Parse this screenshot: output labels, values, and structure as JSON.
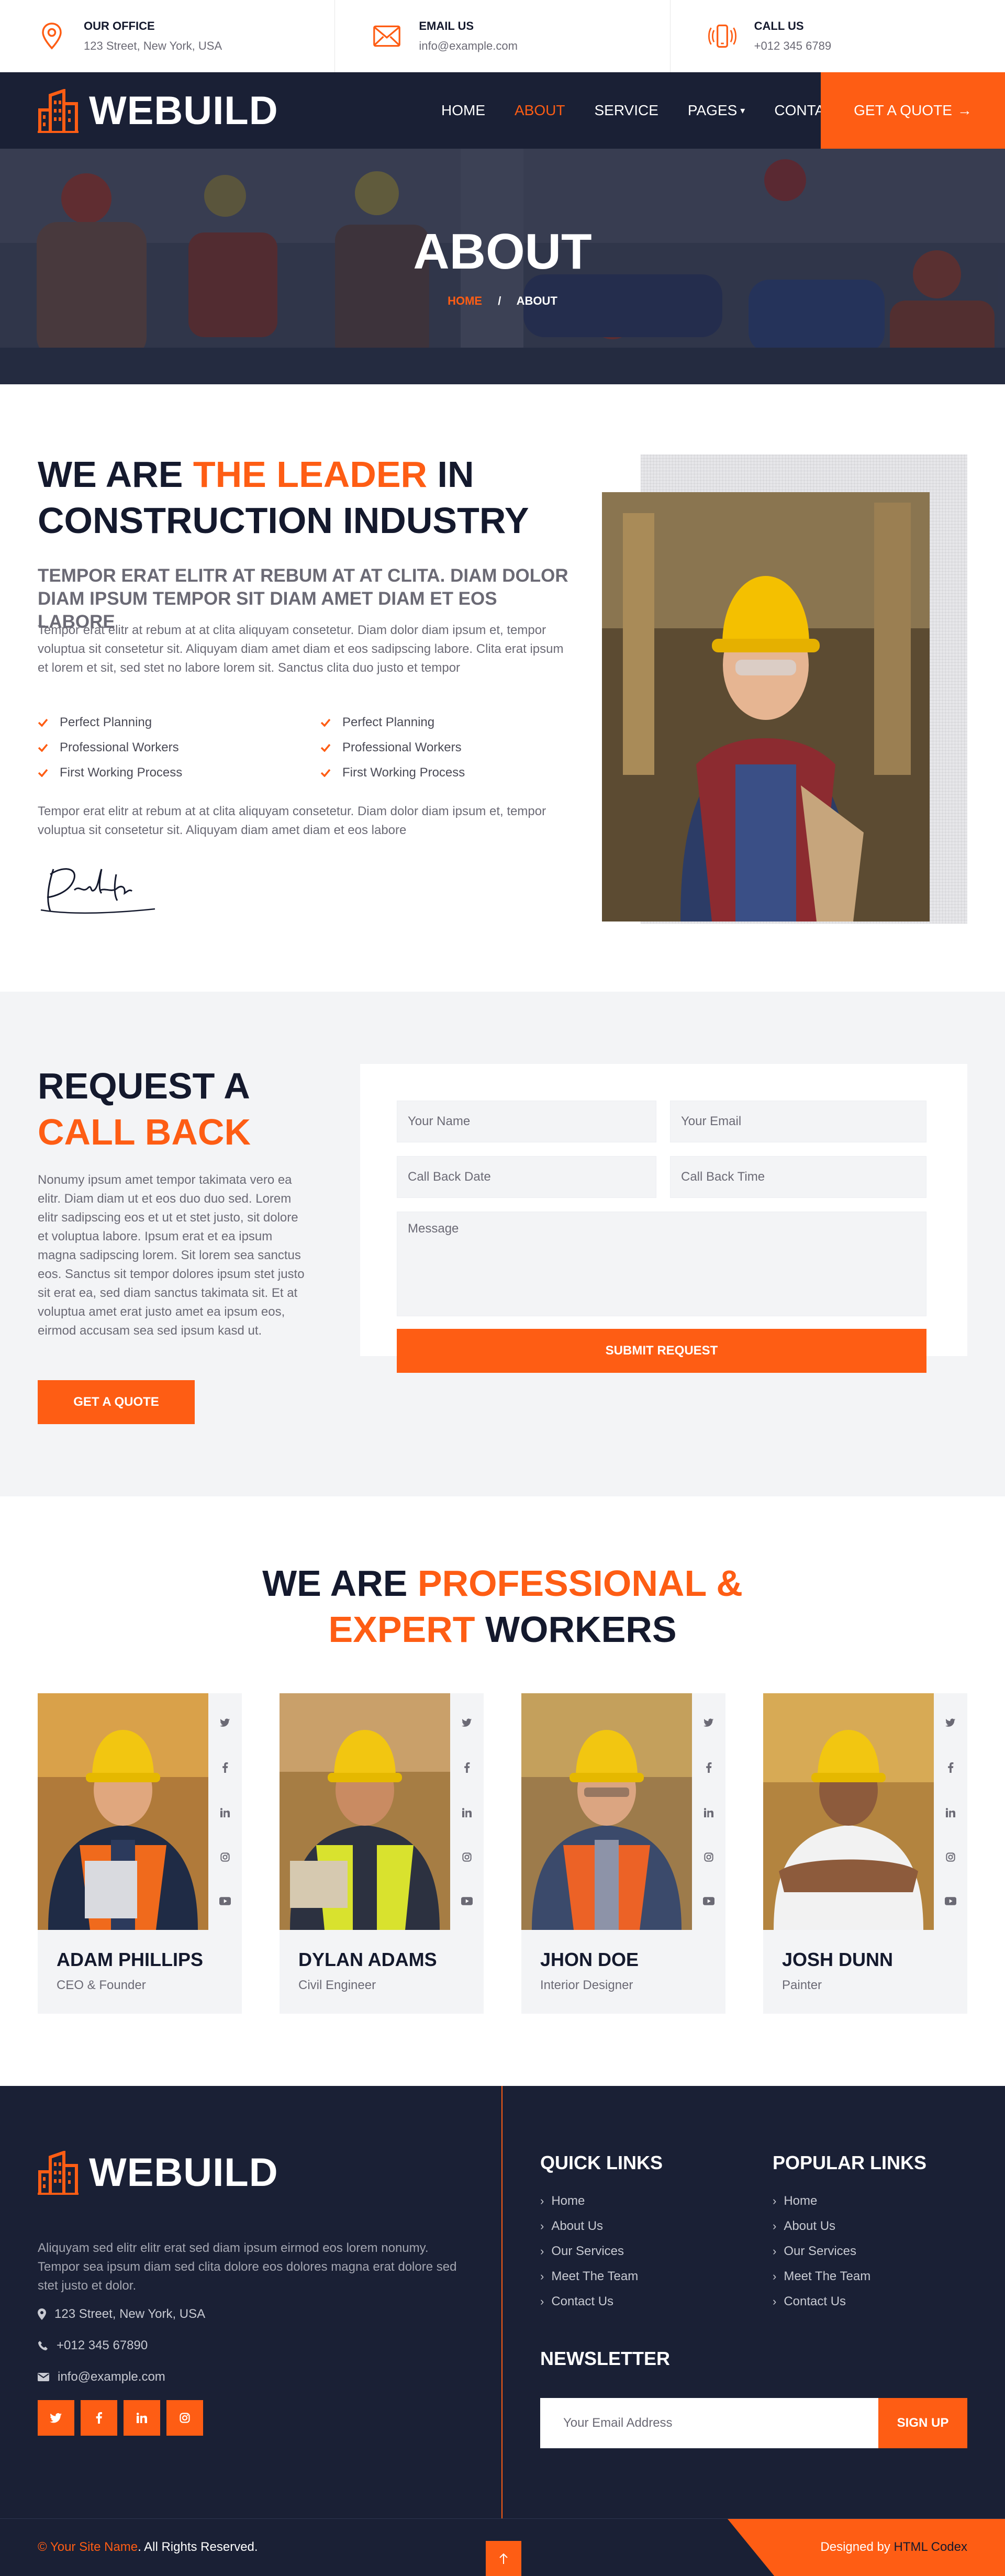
{
  "brand": {
    "name": "WEBUILD"
  },
  "colors": {
    "accent": "#fe5d14",
    "dark": "#1a2035",
    "heading": "#14192d"
  },
  "topbar": [
    {
      "icon": "map-marker-icon",
      "title": "OUR OFFICE",
      "value": "123 Street, New York, USA"
    },
    {
      "icon": "envelope-icon",
      "title": "EMAIL US",
      "value": "info@example.com"
    },
    {
      "icon": "phone-icon",
      "title": "CALL US",
      "value": "+012 345 6789"
    }
  ],
  "nav": {
    "items": [
      "HOME",
      "ABOUT",
      "SERVICE",
      "PAGES",
      "CONTACT"
    ],
    "active": "ABOUT",
    "quote": "GET A QUOTE"
  },
  "hero": {
    "title": "ABOUT",
    "crumb_home": "HOME",
    "crumb_sep": "/",
    "crumb_current": "ABOUT"
  },
  "about": {
    "h_part1": "WE ARE ",
    "h_accent": "THE LEADER",
    "h_part2": " IN",
    "h_line2": "CONSTRUCTION INDUSTRY",
    "subtitle": "TEMPOR ERAT ELITR AT REBUM AT AT CLITA. DIAM DOLOR DIAM IPSUM TEMPOR SIT DIAM AMET DIAM ET EOS LABORE",
    "para1": "Tempor erat elitr at rebum at at clita aliquyam consetetur. Diam dolor diam ipsum et, tempor voluptua sit consetetur sit. Aliquyam diam amet diam et eos sadipscing labore. Clita erat ipsum et lorem et sit, sed stet no labore lorem sit. Sanctus clita duo justo et tempor",
    "checks": [
      "Perfect Planning",
      "Perfect Planning",
      "Professional Workers",
      "Professional Workers",
      "First Working Process",
      "First Working Process"
    ],
    "para2": "Tempor erat elitr at rebum at at clita aliquyam consetetur. Diam dolor diam ipsum et, tempor voluptua sit consetetur sit. Aliquyam diam amet diam et eos labore",
    "signature_text": "P.Smith"
  },
  "request": {
    "h_line1": "REQUEST A",
    "h_line2": "CALL BACK",
    "para": "Nonumy ipsum amet tempor takimata vero ea elitr. Diam diam ut et eos duo duo sed. Lorem elitr sadipscing eos et ut et stet justo, sit dolore et voluptua labore. Ipsum erat et ea ipsum magna sadipscing lorem. Sit lorem sea sanctus eos. Sanctus sit tempor dolores ipsum stet justo sit erat ea, sed diam sanctus takimata sit. Et at voluptua amet erat justo amet ea ipsum eos, eirmod accusam sea sed ipsum kasd ut.",
    "button": "GET A QUOTE",
    "form": {
      "name": "Your Name",
      "email": "Your Email",
      "date": "Call Back Date",
      "time": "Call Back Time",
      "message": "Message",
      "submit": "SUBMIT REQUEST"
    }
  },
  "team": {
    "h_part1": "WE ARE ",
    "h_accent1": "PROFESSIONAL &",
    "h_accent2": "EXPERT",
    "h_part2": " WORKERS",
    "members": [
      {
        "name": "ADAM PHILLIPS",
        "role": "CEO & Founder"
      },
      {
        "name": "DYLAN ADAMS",
        "role": "Civil Engineer"
      },
      {
        "name": "JHON DOE",
        "role": "Interior Designer"
      },
      {
        "name": "JOSH DUNN",
        "role": "Painter"
      }
    ],
    "social_icons": [
      "twitter-icon",
      "facebook-icon",
      "linkedin-icon",
      "instagram-icon",
      "youtube-icon"
    ]
  },
  "footer": {
    "about": "Aliquyam sed elitr elitr erat sed diam ipsum eirmod eos lorem nonumy. Tempor sea ipsum diam sed clita dolore eos dolores magna erat dolore sed stet justo et dolor.",
    "address": "123 Street, New York, USA",
    "phone": "+012 345 67890",
    "email": "info@example.com",
    "quick_title": "QUICK LINKS",
    "quick_links": [
      "Home",
      "About Us",
      "Our Services",
      "Meet The Team",
      "Contact Us"
    ],
    "popular_title": "POPULAR LINKS",
    "popular_links": [
      "Home",
      "About Us",
      "Our Services",
      "Meet The Team",
      "Contact Us"
    ],
    "newsletter_title": "NEWSLETTER",
    "newsletter_placeholder": "Your Email Address",
    "newsletter_button": "SIGN UP",
    "copy_symbol": "©",
    "site_name": "Your Site Name",
    "rights": ". All Rights Reserved.",
    "designed_by": "Designed by ",
    "designer": "HTML Codex"
  }
}
